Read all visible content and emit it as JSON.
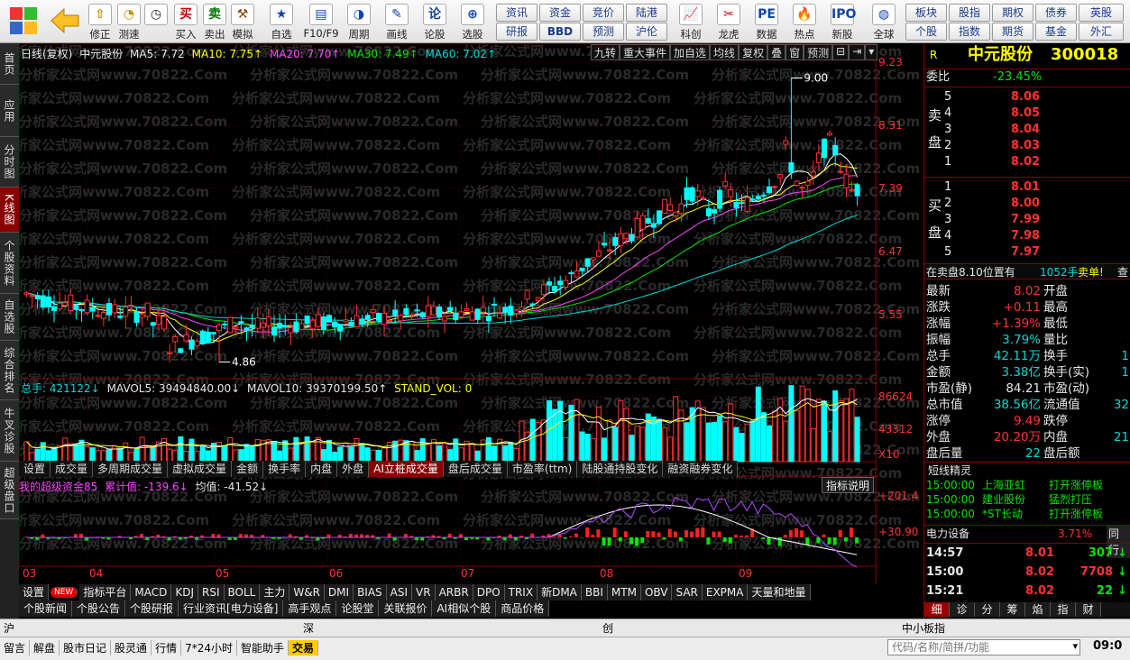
{
  "toolbar": {
    "groups": [
      {
        "label": "",
        "icon": "grid-icon"
      },
      {
        "label": "",
        "icon": "back-arrow-icon"
      },
      {
        "label": "修正",
        "icon": "up-arrow-icon"
      },
      {
        "label": "测速",
        "icon": "speed-icon"
      },
      {
        "label": "",
        "icon": "clock-icon"
      },
      {
        "label": "买入",
        "icon": "buy-icon"
      },
      {
        "label": "卖出",
        "icon": "sell-icon"
      },
      {
        "label": "模拟",
        "icon": "hammer-icon"
      },
      {
        "label": "自选",
        "icon": "star-icon"
      },
      {
        "label": "F10/F9",
        "icon": "f10-icon"
      },
      {
        "label": "周期",
        "icon": "period-icon"
      },
      {
        "label": "画线",
        "icon": "pencil-icon"
      },
      {
        "label": "论股",
        "icon": "discuss-icon"
      },
      {
        "label": "选股",
        "icon": "select-icon"
      },
      {
        "label": "科创",
        "icon": "tech-icon"
      },
      {
        "label": "龙虎",
        "icon": "dragon-icon"
      },
      {
        "label": "数据",
        "icon": "data-icon"
      },
      {
        "label": "热点",
        "icon": "hot-icon"
      },
      {
        "label": "新股",
        "icon": "ipo-icon"
      },
      {
        "label": "全球",
        "icon": "globe-icon"
      }
    ],
    "small_buttons_col1": [
      "资讯",
      "研报"
    ],
    "small_buttons_col2": [
      "资金",
      "BBD"
    ],
    "small_buttons_col3": [
      "竞价",
      "预测"
    ],
    "small_buttons_col4": [
      "陆港",
      "沪伦"
    ],
    "right_col1": [
      "板块",
      "个股"
    ],
    "right_col2": [
      "股指",
      "指数"
    ],
    "right_col3": [
      "期权",
      "期货"
    ],
    "right_col4": [
      "债券",
      "基金"
    ],
    "right_col5": [
      "英股",
      "外汇"
    ]
  },
  "left_tabs": [
    "首页",
    "应用",
    "分时图",
    "K线图",
    "个股资料",
    "自选股",
    "综合排名",
    "牛叉诊股",
    "超级盘口"
  ],
  "chart_header": {
    "title": "日线(复权)",
    "stock": "中元股份",
    "ma5": "MA5: 7.72",
    "ma10": "MA10: 7.75↑",
    "ma20": "MA20: 7.70↑",
    "ma30": "MA30: 7.49↑",
    "ma60": "MA60: 7.02↑",
    "buttons": [
      "九转",
      "重大事件",
      "加自选",
      "均线",
      "复权",
      "叠",
      "窗",
      "预测"
    ]
  },
  "chart_data": {
    "type": "candlestick",
    "price_axis_ticks": [
      "9.23",
      "8.31",
      "7.39",
      "6.47",
      "5.55"
    ],
    "high_label": "9.00",
    "low_label": "4.86",
    "months": [
      "03",
      "04",
      "05",
      "06",
      "07",
      "08",
      "09"
    ],
    "volume_header": {
      "total": "总手: 421122↓",
      "mavol5": "MAVOL5: 39494840.00↓",
      "mavol10": "MAVOL10: 39370199.50↑",
      "stand": "STAND_VOL: 0"
    },
    "volume_ticks": [
      "86624",
      "43312",
      "X10"
    ],
    "indicator_header": {
      "name": "我的超级资金85",
      "cum": "累计值: -139.6↓",
      "avg": "均值: -41.52↓"
    },
    "indicator_ticks": [
      "+201.4",
      "+30.90"
    ],
    "indicator_button": "指标说明"
  },
  "volume_tabs": [
    "设置",
    "成交量",
    "多周期成交量",
    "虚拟成交量",
    "金额",
    "换手率",
    "内盘",
    "外盘",
    "AI立桩成交量",
    "盘后成交量",
    "市盈率(ttm)",
    "陆股通持股变化",
    "融资融券变化"
  ],
  "indicator_tabs": [
    "设置",
    "NEW",
    "指标平台",
    "MACD",
    "KDJ",
    "RSI",
    "BOLL",
    "主力",
    "W&R",
    "DMI",
    "BIAS",
    "ASI",
    "VR",
    "ARBR",
    "DPO",
    "TRIX",
    "新DMA",
    "BBI",
    "MTM",
    "OBV",
    "SAR",
    "EXPMA",
    "天量和地量"
  ],
  "info_tabs": [
    "个股新闻",
    "个股公告",
    "个股研报",
    "行业资讯[电力设备]",
    "高手观点",
    "论股堂",
    "关联报价",
    "AI相似个股",
    "商品价格"
  ],
  "panel": {
    "flag": "R",
    "name": "中元股份",
    "code": "300018",
    "weibi_label": "委比",
    "weibi_value": "-23.45%",
    "sell_label": [
      "卖",
      "盘"
    ],
    "buy_label": [
      "买",
      "盘"
    ],
    "sell": [
      {
        "lvl": "5",
        "price": "8.06"
      },
      {
        "lvl": "4",
        "price": "8.05"
      },
      {
        "lvl": "3",
        "price": "8.04"
      },
      {
        "lvl": "2",
        "price": "8.03"
      },
      {
        "lvl": "1",
        "price": "8.02"
      }
    ],
    "buy": [
      {
        "lvl": "1",
        "price": "8.01"
      },
      {
        "lvl": "2",
        "price": "8.00"
      },
      {
        "lvl": "3",
        "price": "7.99"
      },
      {
        "lvl": "4",
        "price": "7.98"
      },
      {
        "lvl": "5",
        "price": "7.97"
      }
    ],
    "notice": "在卖盘8.10位置有",
    "notice_vol": "1052手",
    "notice_tag": "卖单!",
    "notice_more": "查",
    "stats": [
      {
        "l1": "最新",
        "v1": "8.02",
        "c1": "red",
        "l2": "开盘",
        "v2": ""
      },
      {
        "l1": "涨跌",
        "v1": "+0.11",
        "c1": "red",
        "l2": "最高",
        "v2": ""
      },
      {
        "l1": "涨幅",
        "v1": "+1.39%",
        "c1": "red",
        "l2": "最低",
        "v2": ""
      },
      {
        "l1": "振幅",
        "v1": "3.79%",
        "c1": "cyan",
        "l2": "量比",
        "v2": ""
      },
      {
        "l1": "总手",
        "v1": "42.11万",
        "c1": "cyan",
        "l2": "换手",
        "v2": "1"
      },
      {
        "l1": "金额",
        "v1": "3.38亿",
        "c1": "cyan",
        "l2": "换手(实)",
        "v2": "1"
      },
      {
        "l1": "市盈(静)",
        "v1": "84.21",
        "c1": "wht",
        "l2": "市盈(动)",
        "v2": ""
      },
      {
        "l1": "总市值",
        "v1": "38.56亿",
        "c1": "cyan",
        "l2": "流通值",
        "v2": "32"
      },
      {
        "l1": "涨停",
        "v1": "9.49",
        "c1": "red",
        "l2": "跌停",
        "v2": ""
      },
      {
        "l1": "外盘",
        "v1": "20.20万",
        "c1": "red",
        "l2": "内盘",
        "v2": "21"
      },
      {
        "l1": "盘后量",
        "v1": "22",
        "c1": "cyan",
        "l2": "盘后额",
        "v2": ""
      }
    ],
    "short_title": "短线精灵",
    "short_items": [
      {
        "time": "15:00:00",
        "name": "上海亚虹",
        "event": "打开涨停板"
      },
      {
        "time": "15:00:00",
        "name": "建业股份",
        "event": "猛烈打压"
      },
      {
        "time": "15:00:00",
        "name": "*ST长动",
        "event": "打开涨停板"
      }
    ],
    "industry_name": "电力设备",
    "industry_pct": "3.71%",
    "industry_tab": "同行",
    "ticks": [
      {
        "time": "14:57",
        "price": "8.01",
        "pc": "red",
        "vol": "307",
        "dir": "down"
      },
      {
        "time": "15:00",
        "price": "8.02",
        "pc": "red",
        "vol": "7708",
        "dir": "down"
      },
      {
        "time": "15:21",
        "price": "8.02",
        "pc": "red",
        "vol": "22",
        "dir": "down"
      }
    ],
    "bottom_tabs": [
      "细",
      "诊",
      "分",
      "筹",
      "焰",
      "指",
      "财"
    ]
  },
  "market_bar": {
    "sh": "沪",
    "sz": "深",
    "cy": "创",
    "zxb": "中小板指"
  },
  "statusbar": {
    "items": [
      "留言",
      "解盘",
      "股市日记",
      "股灵通",
      "行情",
      "7*24小时",
      "智能助手",
      "交易"
    ],
    "search_placeholder": "代码/名称/简拼/功能",
    "time": "09:0"
  },
  "watermark": "分析家公式网www.70822.Com"
}
